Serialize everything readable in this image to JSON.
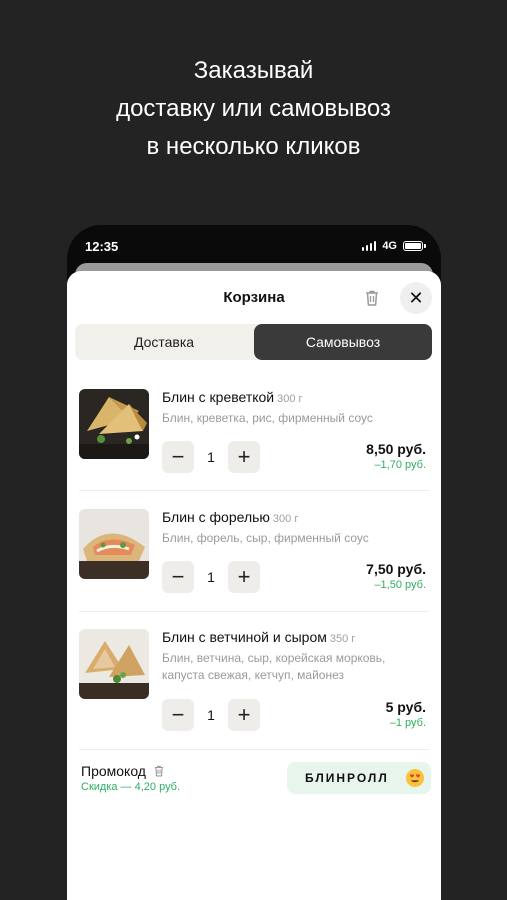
{
  "headline": {
    "line1": "Заказывай",
    "line2": "доставку или самовывоз",
    "line3": "в несколько кликов"
  },
  "status_bar": {
    "time": "12:35",
    "network": "4G"
  },
  "cart": {
    "title": "Корзина",
    "tabs": [
      {
        "label": "Доставка",
        "selected": false
      },
      {
        "label": "Самовывоз",
        "selected": true
      }
    ],
    "items": [
      {
        "name": "Блин с креветкой",
        "weight": "300 г",
        "description": "Блин, креветка, рис, фирменный соус",
        "quantity": "1",
        "price": "8,50 руб.",
        "discount": "–1,70 руб.",
        "minus": "−",
        "plus": "+"
      },
      {
        "name": "Блин с форелью",
        "weight": "300 г",
        "description": "Блин, форель, сыр, фирменный соус",
        "quantity": "1",
        "price": "7,50 руб.",
        "discount": "–1,50 руб.",
        "minus": "−",
        "plus": "+"
      },
      {
        "name": "Блин с ветчиной и сыром",
        "weight": "350 г",
        "description": "Блин, ветчина, сыр, корейская морковь, капуста свежая, кетчуп, майонез",
        "quantity": "1",
        "price": "5 руб.",
        "discount": "–1 руб.",
        "minus": "−",
        "plus": "+"
      }
    ],
    "promo": {
      "label": "Промокод",
      "discount_text": "Скидка — 4,20 руб.",
      "code": "БЛИНРОЛЛ",
      "icon": "heart-eyes-emoji-icon"
    },
    "close_glyph": "✕"
  },
  "colors": {
    "background": "#232323",
    "accent_green": "#2eae62",
    "segment_active": "#3a3a3a",
    "promo_chip": "#e8f5ec"
  }
}
